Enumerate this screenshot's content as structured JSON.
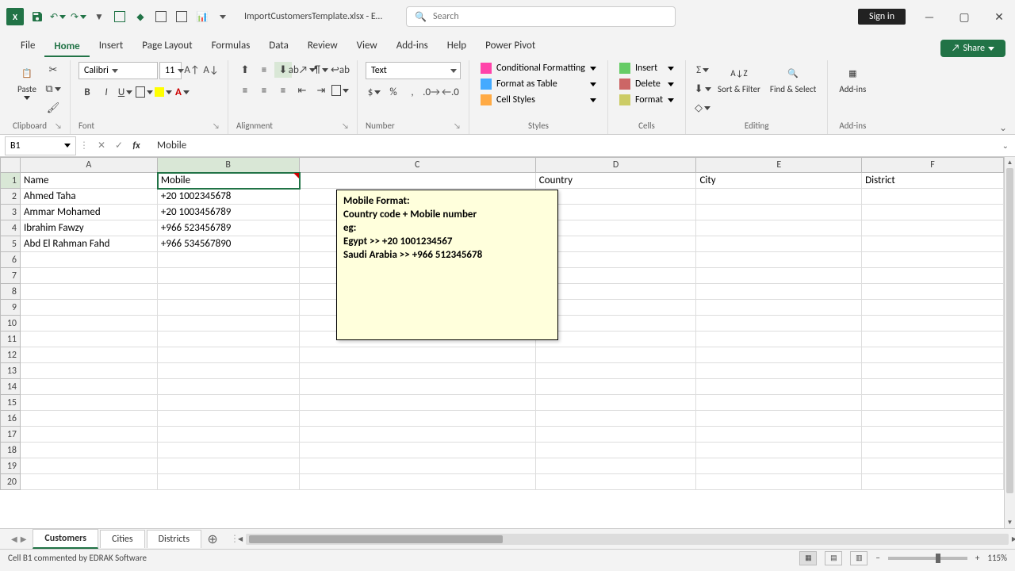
{
  "titlebar": {
    "filename": "ImportCustomersTemplate.xlsx  -  E…",
    "search_placeholder": "Search",
    "signin": "Sign in"
  },
  "ribbon_tabs": [
    "File",
    "Home",
    "Insert",
    "Page Layout",
    "Formulas",
    "Data",
    "Review",
    "View",
    "Add-ins",
    "Help",
    "Power Pivot"
  ],
  "active_ribbon_tab": "Home",
  "share_label": "Share",
  "ribbon": {
    "clipboard": {
      "paste": "Paste",
      "label": "Clipboard"
    },
    "font": {
      "name": "Calibri",
      "size": "11",
      "label": "Font"
    },
    "alignment": {
      "label": "Alignment"
    },
    "number": {
      "format": "Text",
      "label": "Number"
    },
    "styles": {
      "conditional": "Conditional Formatting",
      "table": "Format as Table",
      "cell": "Cell Styles",
      "label": "Styles"
    },
    "cells": {
      "insert": "Insert",
      "delete": "Delete",
      "format": "Format",
      "label": "Cells"
    },
    "editing": {
      "sort": "Sort & Filter",
      "find": "Find & Select",
      "label": "Editing"
    },
    "addins": {
      "btn": "Add-ins",
      "label": "Add-ins"
    }
  },
  "namebox": "B1",
  "formula": "Mobile",
  "columns": [
    "A",
    "B",
    "C",
    "D",
    "E",
    "F"
  ],
  "headers": {
    "A": "Name",
    "B": "Mobile",
    "C": "",
    "D": "Country",
    "E": "City",
    "F": "District"
  },
  "data_rows": [
    {
      "A": "Ahmed Taha",
      "B": "+20 1002345678"
    },
    {
      "A": "Ammar Mohamed",
      "B": "+20 1003456789"
    },
    {
      "A": "Ibrahim Fawzy",
      "B": "+966 523456789"
    },
    {
      "A": "Abd El Rahman Fahd",
      "B": "+966 534567890"
    }
  ],
  "comment": {
    "l1": "Mobile Format:",
    "l2": "Country code + Mobile number",
    "l3": "eg:",
    "l4": "Egypt >> +20 1001234567",
    "l5": "Saudi Arabia >> +966 512345678"
  },
  "row_numbers": [
    "1",
    "2",
    "3",
    "4",
    "5",
    "6",
    "7",
    "8",
    "9",
    "10",
    "11",
    "12",
    "13",
    "14",
    "15",
    "16",
    "17",
    "18",
    "19",
    "20"
  ],
  "sheet_tabs": [
    "Customers",
    "Cities",
    "Districts"
  ],
  "active_sheet": "Customers",
  "statusbar": {
    "msg": "Cell B1 commented by EDRAK Software",
    "zoom": "115%"
  }
}
